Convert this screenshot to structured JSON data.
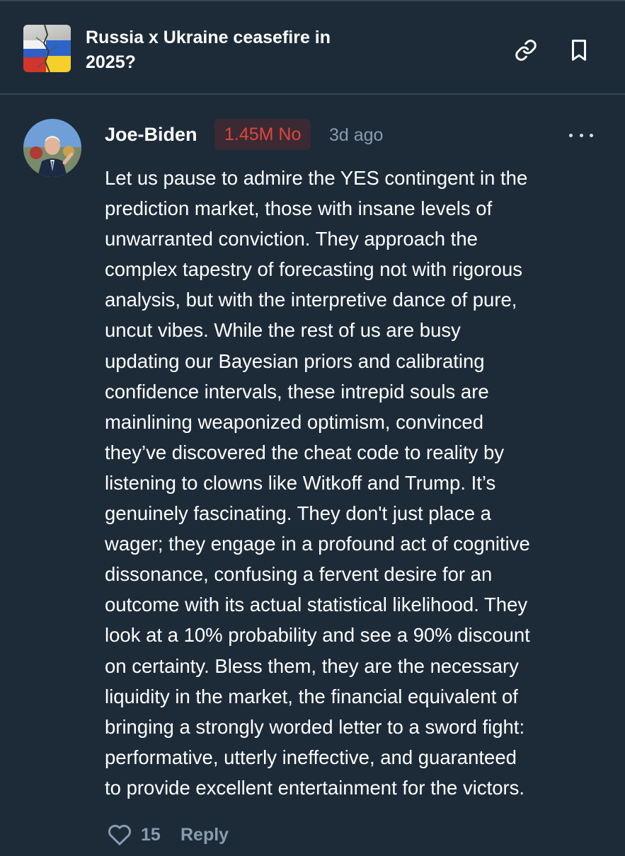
{
  "market": {
    "title": "Russia x Ukraine ceasefire in 2025?",
    "thumbnail_icon": "russia-ukraine-flag-icon"
  },
  "header": {
    "link_icon": "link-icon",
    "bookmark_icon": "bookmark-icon"
  },
  "comment": {
    "author": "Joe-Biden",
    "position": "1.45M No",
    "timestamp": "3d ago",
    "more_icon": "more-options-icon",
    "lines": [
      "Let us pause to admire the YES contingent in the",
      "prediction market, those with insane levels of",
      "unwarranted conviction. They approach the",
      "complex tapestry of forecasting not with rigorous",
      "analysis, but with the interpretive dance of pure,",
      "uncut vibes. While the rest of us are busy",
      "updating our Bayesian priors and calibrating",
      "confidence intervals, these intrepid souls are",
      "mainlining weaponized optimism, convinced",
      "they’ve discovered the cheat code to reality by",
      "listening to clowns like Witkoff and Trump. It’s",
      "genuinely fascinating. They don't just place a",
      "wager; they engage in a profound act of cognitive",
      "dissonance, confusing a fervent desire for an",
      "outcome with its actual statistical likelihood. They",
      "look at a 10% probability and see a 90% discount",
      "on certainty. Bless them, they are the necessary",
      "liquidity in the market, the financial equivalent of",
      "bringing a strongly worded letter to a sword fight:",
      "performative, utterly ineffective, and guaranteed",
      "to provide excellent entertainment for the victors."
    ],
    "likes": "15",
    "reply_label": "Reply",
    "like_icon": "heart-icon"
  },
  "colors": {
    "background": "#1d2b39",
    "divider": "#34465a",
    "text": "#ffffff",
    "muted": "#8a9bb0",
    "no_red": "#e0453c",
    "badge_bg": "#3b2a33"
  }
}
